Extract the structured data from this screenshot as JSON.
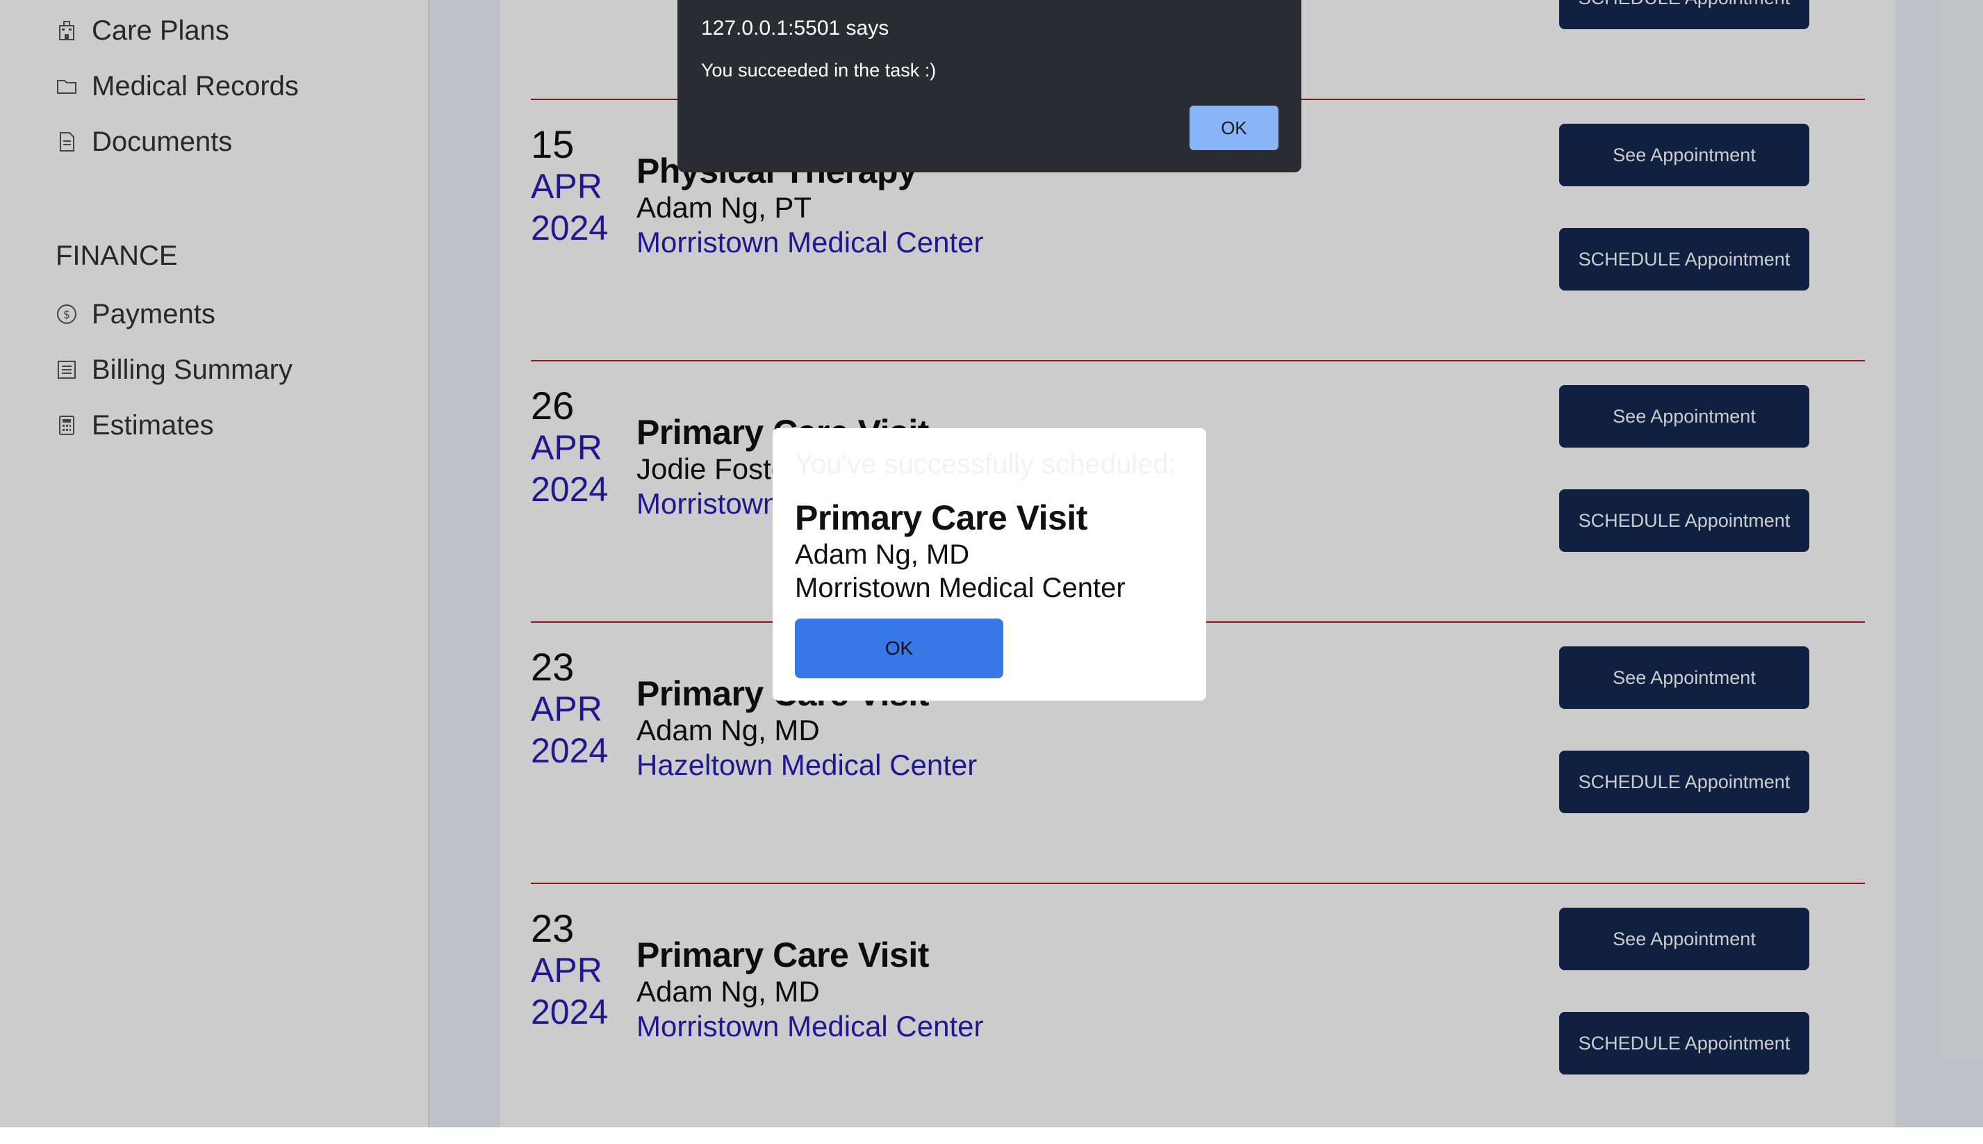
{
  "sidebar": {
    "items_top": [
      {
        "label": "Care Plans",
        "icon": "building-icon"
      },
      {
        "label": "Medical Records",
        "icon": "folder-icon"
      },
      {
        "label": "Documents",
        "icon": "document-icon"
      }
    ],
    "finance_label": "FINANCE",
    "items_finance": [
      {
        "label": "Payments",
        "icon": "dollar-circle-icon"
      },
      {
        "label": "Billing Summary",
        "icon": "list-icon"
      },
      {
        "label": "Estimates",
        "icon": "calculator-icon"
      }
    ]
  },
  "appointments": {
    "top_button_label": "SCHEDULE Appointment",
    "see_label": "See Appointment",
    "schedule_label": "SCHEDULE Appointment",
    "items": [
      {
        "day": "15",
        "month": "APR",
        "year": "2024",
        "title": "Physical Therapy",
        "doctor": "Adam Ng, PT",
        "location": "Morristown Medical Center"
      },
      {
        "day": "26",
        "month": "APR",
        "year": "2024",
        "title": "Primary Care Visit",
        "doctor": "Jodie Foster, MD",
        "location": "Morristown Medical Center"
      },
      {
        "day": "23",
        "month": "APR",
        "year": "2024",
        "title": "Primary Care Visit",
        "doctor": "Adam Ng, MD",
        "location": "Hazeltown Medical Center"
      },
      {
        "day": "23",
        "month": "APR",
        "year": "2024",
        "title": "Primary Care Visit",
        "doctor": "Adam Ng, MD",
        "location": "Morristown Medical Center"
      }
    ]
  },
  "modal": {
    "message": "You've successfully scheduled:",
    "title": "Primary Care Visit",
    "doctor": "Adam Ng, MD",
    "location": "Morristown Medical Center",
    "ok_label": "OK"
  },
  "alert": {
    "origin": "127.0.0.1:5501 says",
    "message": "You succeeded in the task :)",
    "ok_label": "OK"
  },
  "colors": {
    "accent_navy": "#142850",
    "link_blue": "#2a1db5",
    "divider_red": "#b31b1b",
    "modal_ok_blue": "#3778e6",
    "alert_ok_blue": "#8ab4f8"
  }
}
